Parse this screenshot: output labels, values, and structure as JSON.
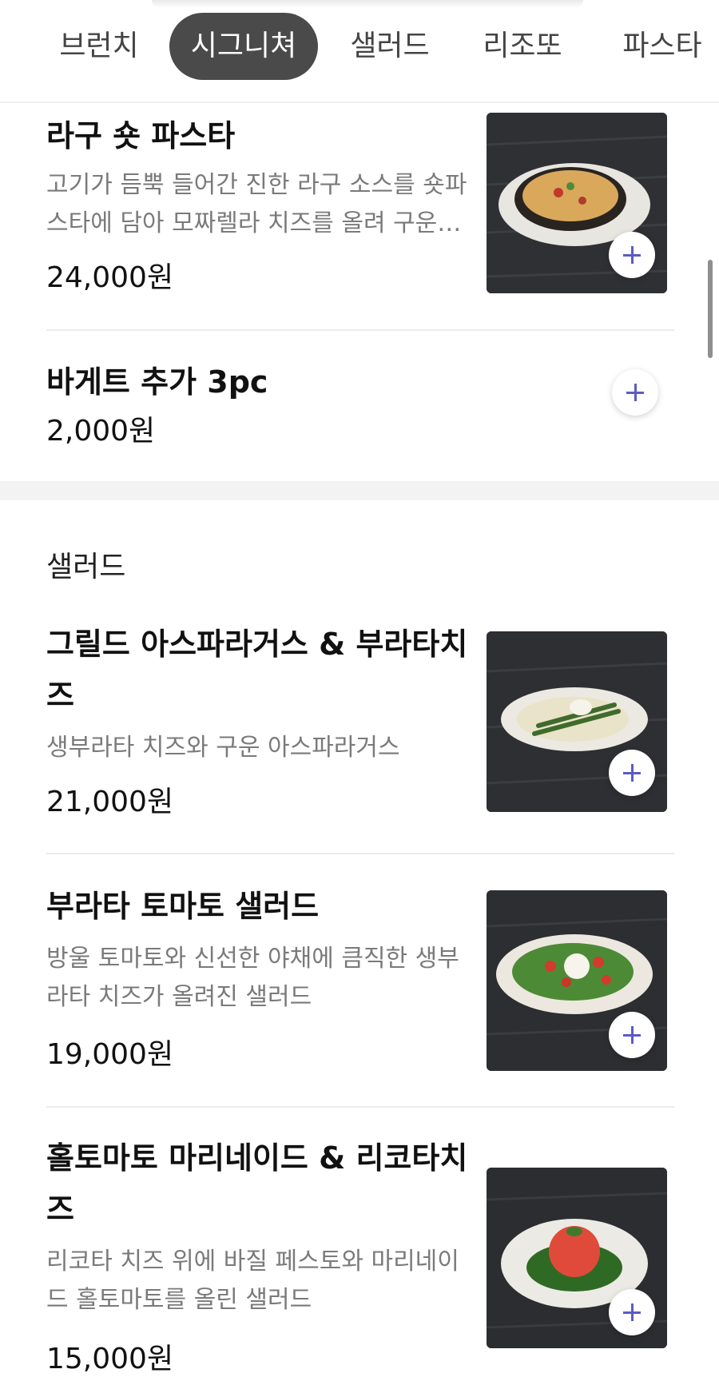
{
  "tabs": [
    "브런치",
    "시그니쳐",
    "샐러드",
    "리조또",
    "파스타"
  ],
  "active_tab": "시그니쳐",
  "items_top": [
    {
      "name": "라구 숏 파스타",
      "desc_line1": "고기가 듬뿍 들어간 진한 라구 소스를 숏파",
      "desc_line2": "스타에 담아 모짜렐라 치즈를 올려 구운…",
      "price": "24,000원"
    },
    {
      "name": "바게트 추가 3pc",
      "price": "2,000원"
    }
  ],
  "salad_section": {
    "title": "샐러드",
    "items": [
      {
        "name_line1": "그릴드 아스파라거스 & 부라타치",
        "name_line2": "즈",
        "desc_line1": "생부라타 치즈와 구운 아스파라거스",
        "price": "21,000원"
      },
      {
        "name_line1": "부라타 토마토 샐러드",
        "desc_line1": "방울 토마토와 신선한 야채에 큼직한 생부",
        "desc_line2": "라타 치즈가 올려진 샐러드",
        "price": "19,000원"
      },
      {
        "name_line1": "홀토마토 마리네이드 & 리코타치",
        "name_line2": "즈",
        "desc_line1": "리코타 치즈 위에 바질 페스토와 마리네이",
        "desc_line2": "드 홀토마토를 올린 샐러드",
        "price": "15,000원"
      }
    ]
  },
  "icons": {
    "add": "plus-icon"
  },
  "colors": {
    "accent": "#5b5bc4",
    "active_tab_bg": "#4a4a4a"
  }
}
